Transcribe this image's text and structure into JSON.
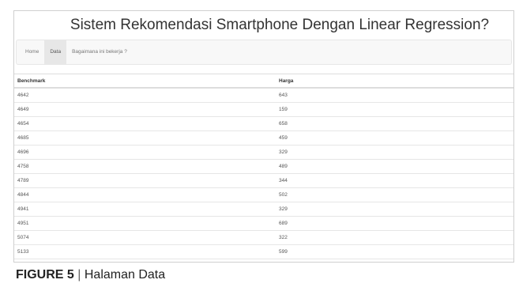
{
  "app": {
    "title": "Sistem Rekomendasi Smartphone Dengan Linear Regression?"
  },
  "nav": {
    "items": [
      {
        "label": "Home",
        "active": false
      },
      {
        "label": "Data",
        "active": true
      },
      {
        "label": "Bagaimana ini bekerja ?",
        "active": false
      }
    ]
  },
  "table": {
    "headers": {
      "benchmark": "Benchmark",
      "harga": "Harga"
    },
    "rows": [
      {
        "benchmark": "4642",
        "harga": "643"
      },
      {
        "benchmark": "4649",
        "harga": "159"
      },
      {
        "benchmark": "4654",
        "harga": "658"
      },
      {
        "benchmark": "4685",
        "harga": "459"
      },
      {
        "benchmark": "4696",
        "harga": "329"
      },
      {
        "benchmark": "4758",
        "harga": "489"
      },
      {
        "benchmark": "4789",
        "harga": "344"
      },
      {
        "benchmark": "4844",
        "harga": "502"
      },
      {
        "benchmark": "4941",
        "harga": "329"
      },
      {
        "benchmark": "4951",
        "harga": "689"
      },
      {
        "benchmark": "5074",
        "harga": "322"
      },
      {
        "benchmark": "5133",
        "harga": "599"
      }
    ]
  },
  "caption": {
    "figure": "FIGURE 5",
    "separator": "|",
    "text": "Halaman Data"
  },
  "colors": {
    "navbar_bg": "#f8f8f8",
    "active_nav_bg": "#e7e7e7",
    "border": "#dddddd"
  }
}
